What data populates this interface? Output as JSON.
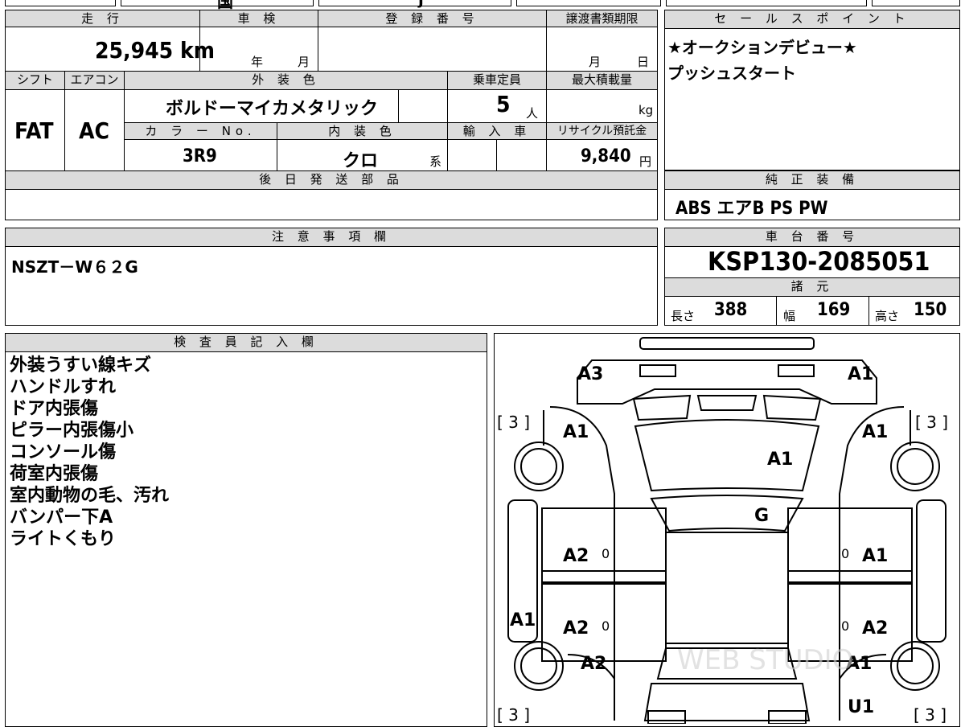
{
  "top_strip": {
    "text1": "国",
    "text2": "j"
  },
  "vehicle_info": {
    "mileage_label": "走 行",
    "mileage_value": "25,945 km",
    "inspection_label": "車 検",
    "inspection_year": "年",
    "inspection_month": "月",
    "registration_label": "登 録 番 号",
    "transfer_label": "譲渡書類期限",
    "transfer_month": "月",
    "transfer_day": "日",
    "shift_label": "シフト",
    "shift_value": "FAT",
    "ac_label": "エアコン",
    "ac_value": "AC",
    "exterior_label": "外 装 色",
    "exterior_value": "ボルドーマイカメタリック",
    "capacity_label": "乗車定員",
    "capacity_value": "5",
    "capacity_unit": "人",
    "maxload_label": "最大積載量",
    "maxload_unit": "kg",
    "color_no_label": "カ ラ ー No.",
    "color_no_value": "3R9",
    "interior_label": "内 装 色",
    "interior_value": "クロ",
    "interior_suffix": "系",
    "import_label": "輸 入 車",
    "recycle_label": "リサイクル預託金",
    "recycle_value": "9,840",
    "recycle_unit": "円",
    "later_parts_label": "後 日 発 送 部 品"
  },
  "sales_points": {
    "label": "セ ー ル ス ポ イ ン ト",
    "lines": [
      "★オークションデビュー★",
      "プッシュスタート"
    ]
  },
  "standard_equipment": {
    "label": "純 正 装 備",
    "value": "ABS エアB PS PW"
  },
  "notes": {
    "label": "注 意 事 項 欄",
    "value": "NSZT－W６２G"
  },
  "chassis": {
    "label": "車 台 番 号",
    "value": "KSP130-2085051",
    "specs_label": "諸 元",
    "length_label": "長さ",
    "length_value": "388",
    "width_label": "幅",
    "width_value": "169",
    "height_label": "高さ",
    "height_value": "150"
  },
  "inspector": {
    "label": "検 査 員 記 入 欄",
    "lines": [
      "外装うすい線キズ",
      "ハンドルすれ",
      "ドア内張傷",
      "ピラー内張傷小",
      "コンソール傷",
      "荷室内張傷",
      "室内動物の毛、汚れ",
      "バンパー下A",
      "ライトくもり"
    ]
  },
  "diagram": {
    "marks": {
      "front_left": "A3",
      "front_right": "A1",
      "fender_left": "A1",
      "fender_right": "A1",
      "hood": "A1",
      "windshield": "G",
      "front_door_left": "A2",
      "front_door_right": "A1",
      "rear_door_left": "A2",
      "rear_door_right": "A2",
      "side_left": "A1",
      "rear_fender_left": "A2",
      "rear_fender_right": "A1",
      "rear_right": "U1"
    },
    "tire_marks": [
      "[ 3 ]",
      "[ 3 ]",
      "[ 3 ]",
      "[ 3 ]"
    ],
    "door_zeros": [
      "0",
      "0",
      "0",
      "0"
    ],
    "watermark": "WEB STUDIO"
  }
}
